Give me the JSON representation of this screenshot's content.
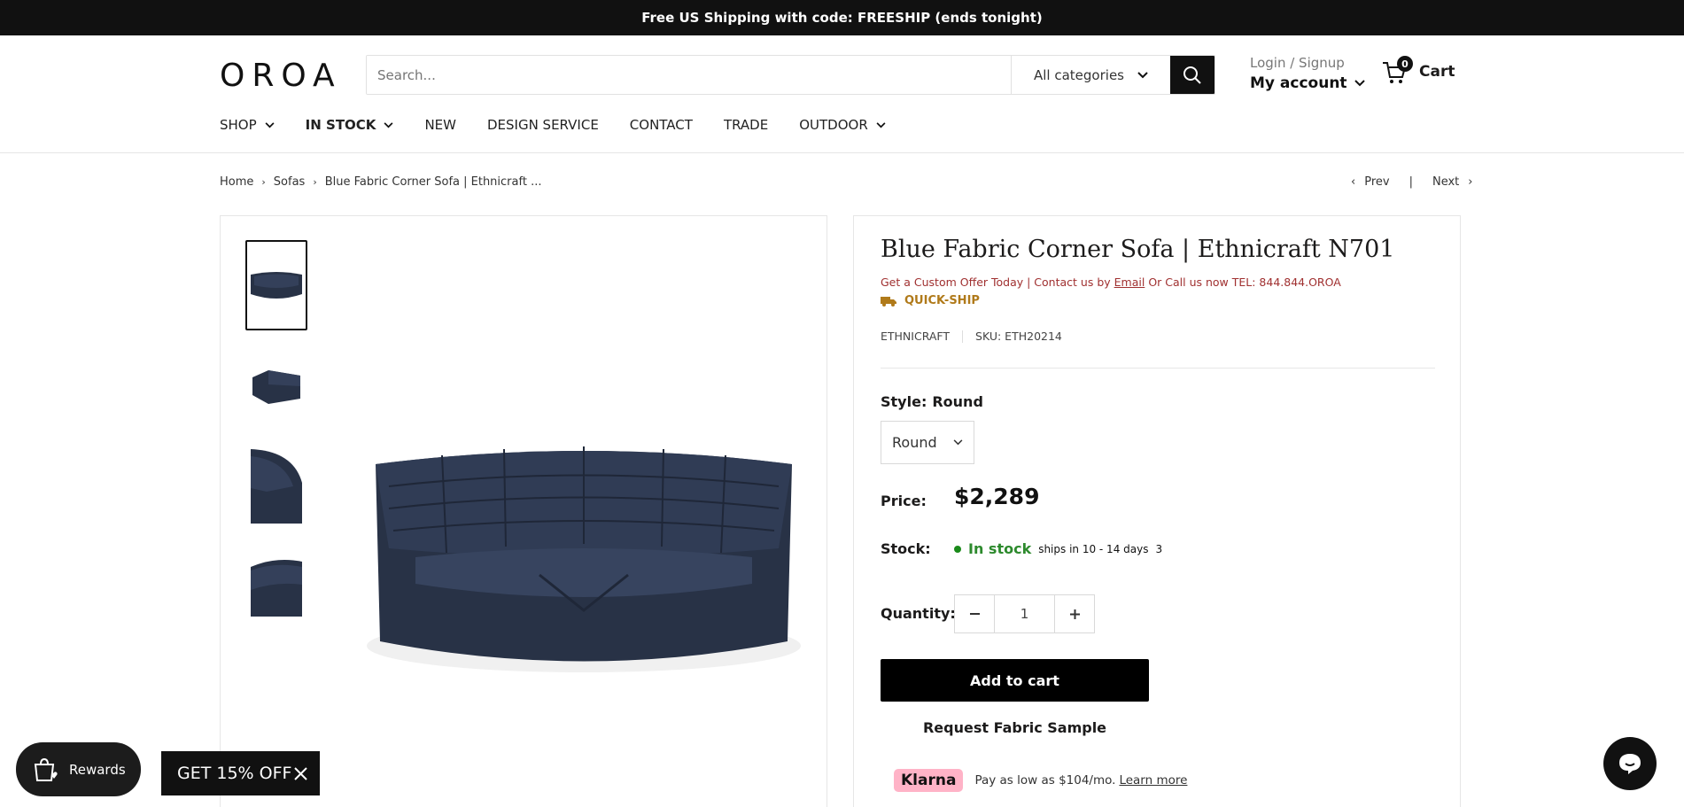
{
  "announcement": "Free US Shipping with code: FREESHIP (ends tonight)",
  "header": {
    "logo": "OROA",
    "search_placeholder": "Search...",
    "category": "All categories",
    "login_text": "Login / Signup",
    "account_label": "My account",
    "cart_count": "0",
    "cart_label": "Cart"
  },
  "nav": {
    "items": [
      {
        "label": "SHOP"
      },
      {
        "label": "IN STOCK"
      },
      {
        "label": "NEW"
      },
      {
        "label": "DESIGN SERVICE"
      },
      {
        "label": "CONTACT"
      },
      {
        "label": "TRADE"
      },
      {
        "label": "OUTDOOR"
      }
    ]
  },
  "breadcrumb": {
    "items": [
      "Home",
      "Sofas",
      "Blue Fabric Corner Sofa | Ethnicraft ..."
    ],
    "prev": "Prev",
    "next": "Next",
    "divider": "|"
  },
  "product": {
    "title": "Blue Fabric Corner Sofa | Ethnicraft N701",
    "custom_offer_prefix": "Get a Custom Offer Today | Contact us by",
    "custom_offer_link": "Email",
    "custom_offer_suffix": "Or Call us now TEL: 844.844.OROA",
    "quick_ship": "QUICK-SHIP",
    "brand": "ETHNICRAFT",
    "sku": "SKU: ETH20214",
    "style_label": "Style:",
    "style_value": "Round",
    "style_select": "Round",
    "price_label": "Price:",
    "price": "$2,289",
    "stock_label": "Stock:",
    "stock_status": "In stock",
    "stock_note": "ships in 10 - 14 days",
    "stock_count": "3",
    "quantity_label": "Quantity:",
    "quantity": "1",
    "add_to_cart": "Add to cart",
    "sample": "Request Fabric Sample",
    "klarna_badge": "Klarna",
    "klarna_text": "Pay as low as $104/mo.",
    "klarna_link": "Learn more"
  },
  "widgets": {
    "rewards": "Rewards",
    "promo": "GET 15% OFF"
  },
  "colors": {
    "sofa": "#283246",
    "accent_red": "#a03030",
    "quick_ship": "#b07a1a",
    "stock_green": "#2d8a2d",
    "klarna_pink": "#ffb3c7"
  }
}
